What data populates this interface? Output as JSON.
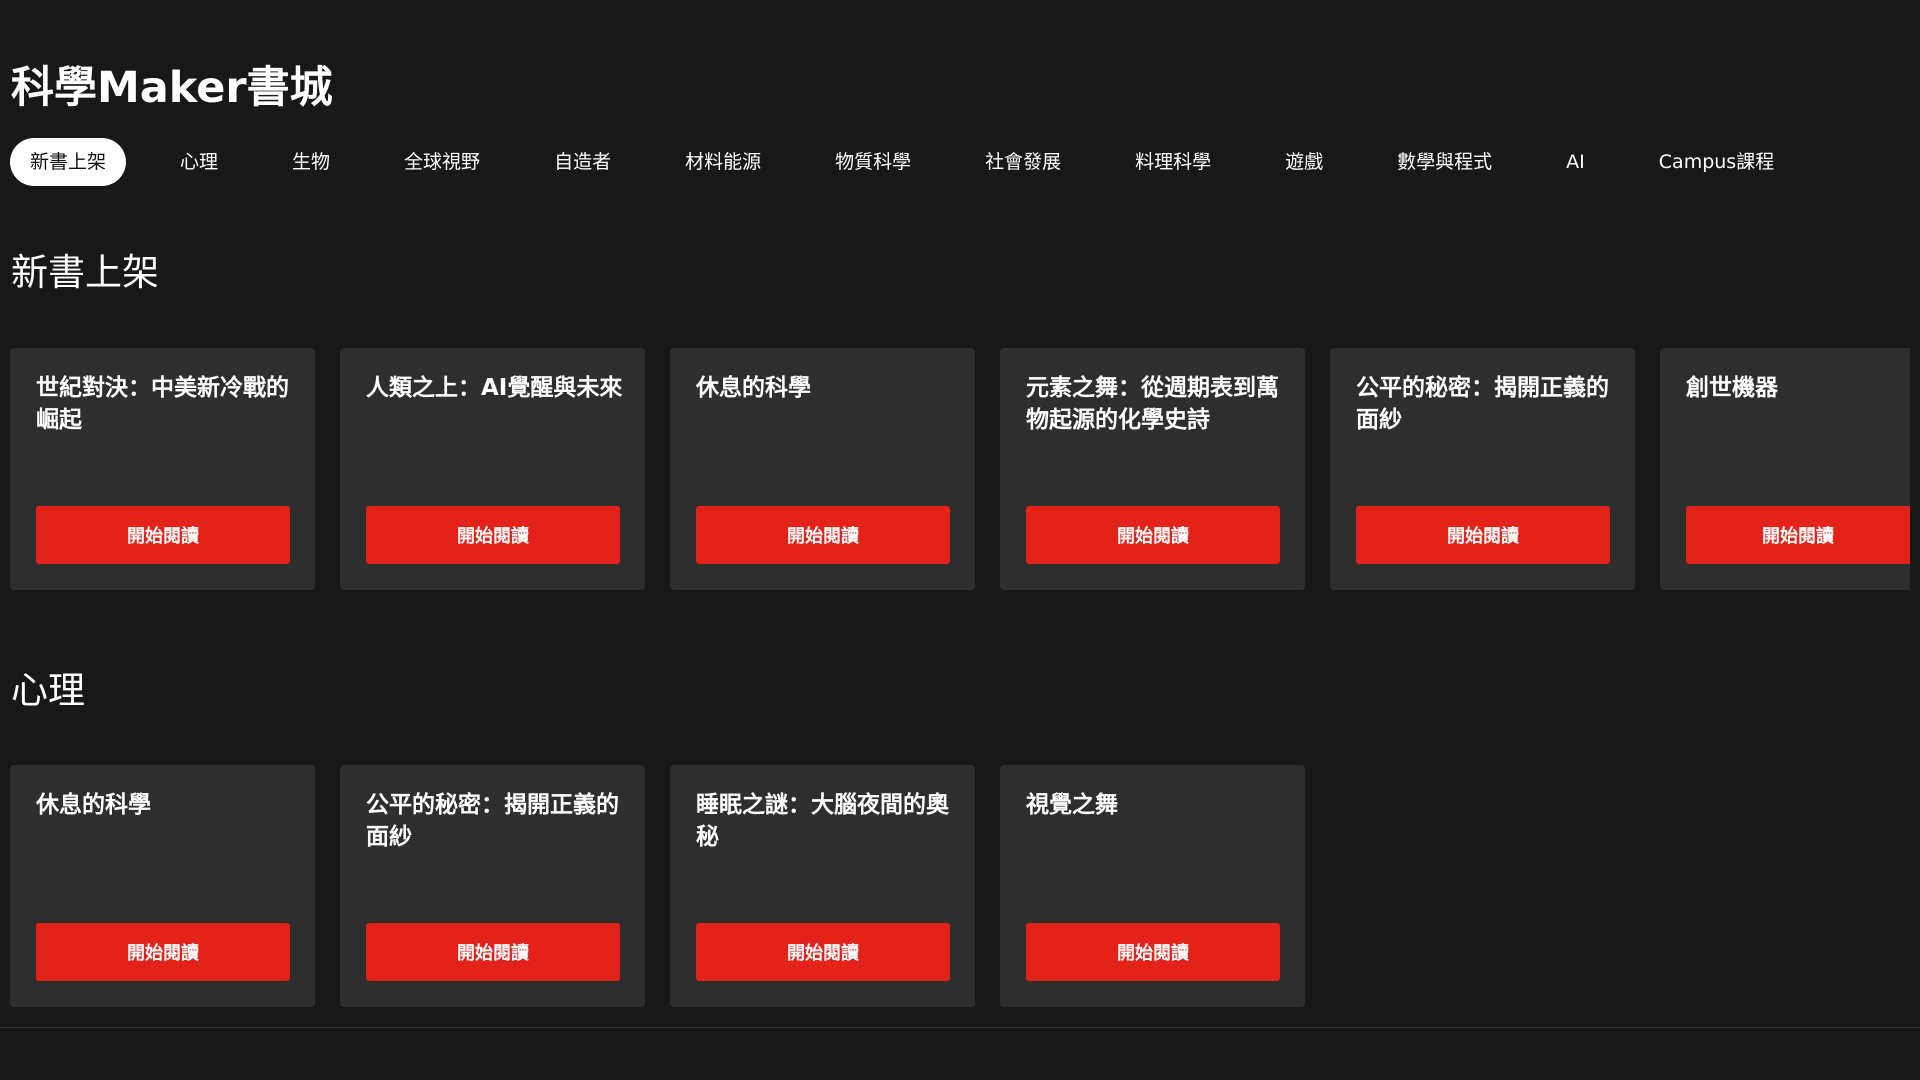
{
  "site": {
    "title": "科學Maker書城"
  },
  "nav": {
    "items": [
      {
        "label": "新書上架",
        "active": true
      },
      {
        "label": "心理"
      },
      {
        "label": "生物"
      },
      {
        "label": "全球視野"
      },
      {
        "label": "自造者"
      },
      {
        "label": "材料能源"
      },
      {
        "label": "物質科學"
      },
      {
        "label": "社會發展"
      },
      {
        "label": "料理科學"
      },
      {
        "label": "遊戲"
      },
      {
        "label": "數學與程式"
      },
      {
        "label": "AI"
      },
      {
        "label": "Campus課程"
      }
    ]
  },
  "sections": [
    {
      "heading": "新書上架",
      "books": [
        {
          "title": "世紀對決：中美新冷戰的崛起",
          "button": "開始閱讀"
        },
        {
          "title": "人類之上：AI覺醒與未來",
          "button": "開始閱讀"
        },
        {
          "title": "休息的科學",
          "button": "開始閱讀"
        },
        {
          "title": "元素之舞：從週期表到萬物起源的化學史詩",
          "button": "開始閱讀"
        },
        {
          "title": "公平的秘密：揭開正義的面紗",
          "button": "開始閱讀"
        },
        {
          "title": "創世機器",
          "button": "開始閱讀"
        }
      ]
    },
    {
      "heading": "心理",
      "books": [
        {
          "title": "休息的科學",
          "button": "開始閱讀"
        },
        {
          "title": "公平的秘密：揭開正義的面紗",
          "button": "開始閱讀"
        },
        {
          "title": "睡眠之謎：大腦夜間的奧秘",
          "button": "開始閱讀"
        },
        {
          "title": "視覺之舞",
          "button": "開始閱讀"
        }
      ]
    }
  ],
  "colors": {
    "background": "#181818",
    "card": "#2e2e2e",
    "accent": "#e3221a",
    "active_tab_bg": "#ffffff"
  }
}
